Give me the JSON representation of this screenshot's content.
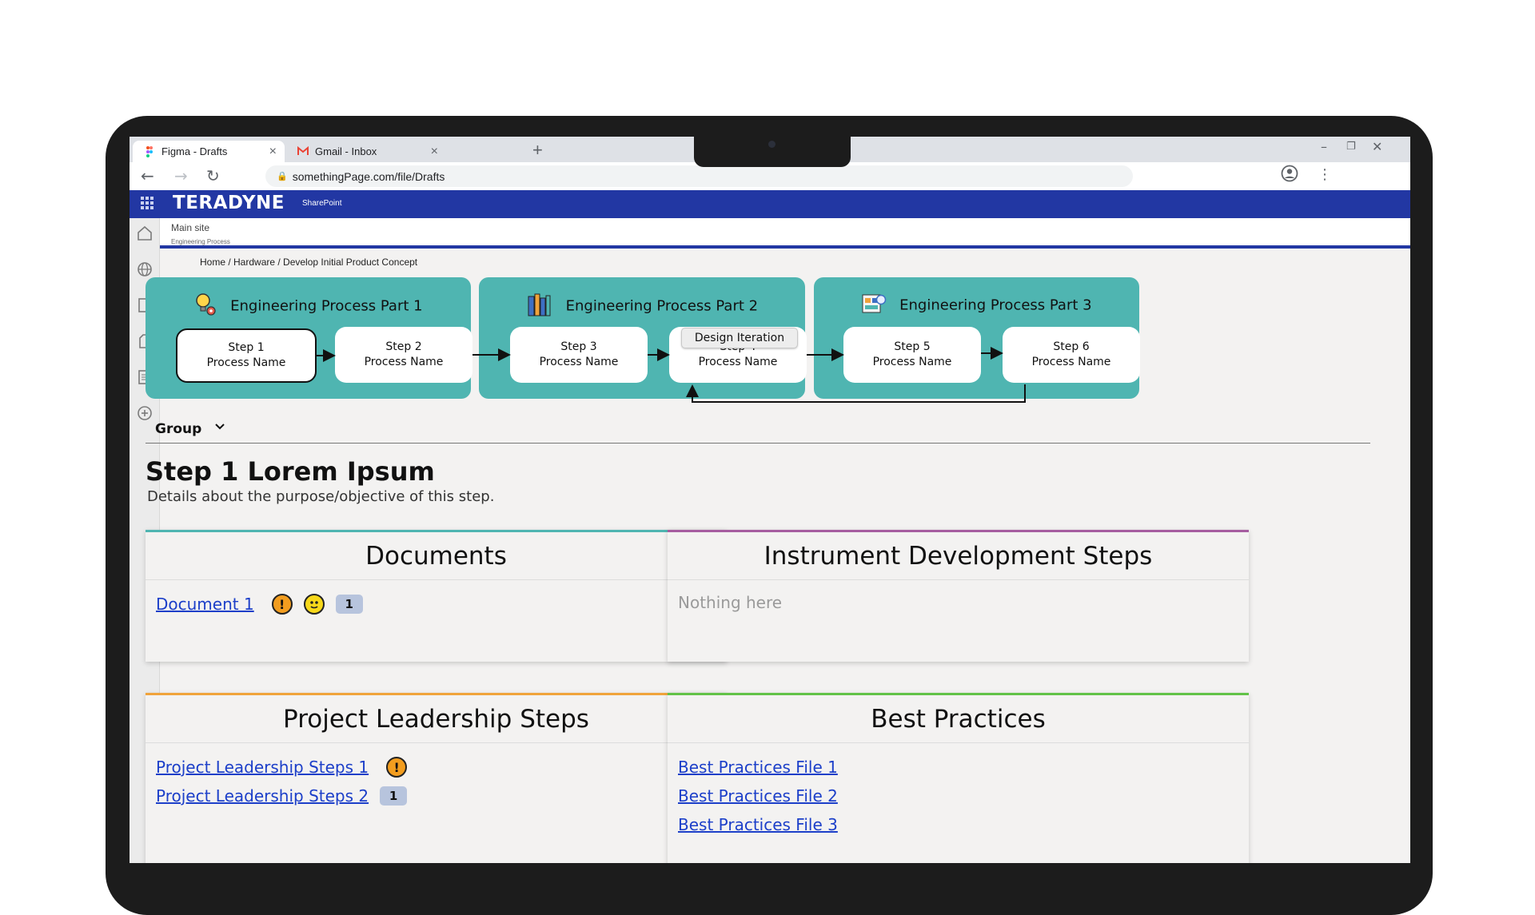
{
  "browser": {
    "tabs": [
      {
        "title": "Figma - Drafts",
        "icon": "figma-icon",
        "active": true
      },
      {
        "title": "Gmail - Inbox",
        "icon": "gmail-icon",
        "active": false
      }
    ],
    "url": "somethingPage.com/file/Drafts"
  },
  "sharepoint": {
    "brand": "TERADYNE",
    "brand_sub": "SharePoint",
    "site_title": "Main site",
    "site_subtitle": "Engineering Process"
  },
  "breadcrumb": "Home  /  Hardware  /  Develop Initial Product Concept",
  "process": {
    "parts": [
      {
        "title": "Engineering Process Part 1",
        "icon": "lightbulb-gear-icon"
      },
      {
        "title": "Engineering Process Part 2",
        "icon": "books-ruler-icon"
      },
      {
        "title": "Engineering Process Part 3",
        "icon": "blueprint-icon"
      }
    ],
    "steps": [
      {
        "name": "Step 1",
        "sub": "Process Name"
      },
      {
        "name": "Step 2",
        "sub": "Process Name"
      },
      {
        "name": "Step 3",
        "sub": "Process Name"
      },
      {
        "name": "Step 4",
        "sub": "Process Name"
      },
      {
        "name": "Step 5",
        "sub": "Process Name"
      },
      {
        "name": "Step 6",
        "sub": "Process Name"
      }
    ],
    "iteration_label": "Design Iteration"
  },
  "group": {
    "label": "Group"
  },
  "step_detail": {
    "title": "Step 1 Lorem Ipsum",
    "description": "Details about the purpose/objective of this step."
  },
  "cards": {
    "documents": {
      "title": "Documents",
      "accent": "#4fb5b1",
      "items": [
        {
          "label": "Document 1",
          "count": "1"
        }
      ]
    },
    "instrument": {
      "title": "Instrument Development Steps",
      "accent": "#a65da0",
      "empty": "Nothing here"
    },
    "leadership": {
      "title": "Project Leadership Steps",
      "accent": "#f0a33b",
      "items": [
        {
          "label": "Project Leadership Steps 1"
        },
        {
          "label": "Project Leadership Steps 2",
          "count": "1"
        }
      ]
    },
    "best_practices": {
      "title": "Best Practices",
      "accent": "#62c248",
      "items": [
        {
          "label": "Best Practices File 1"
        },
        {
          "label": "Best Practices File 2"
        },
        {
          "label": "Best Practices File 3"
        }
      ]
    }
  }
}
